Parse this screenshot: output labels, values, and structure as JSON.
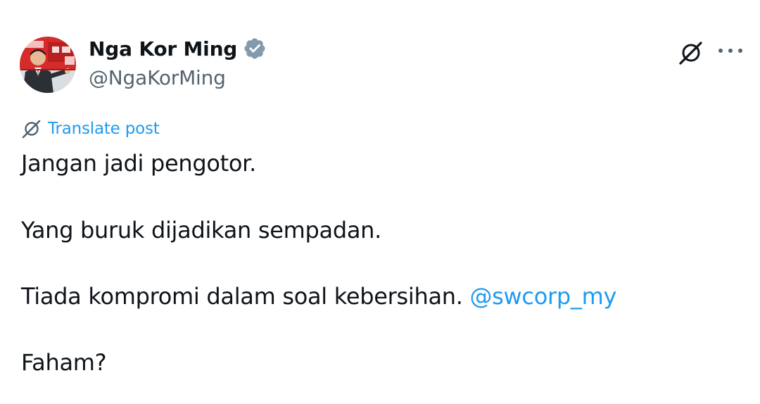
{
  "author": {
    "display_name": "Nga Kor Ming",
    "handle": "@NgaKorMing",
    "verified": true
  },
  "icons": {
    "avatar": "profile-photo",
    "verified": "verified-badge-icon",
    "grok": "grok-icon",
    "more": "more-options-icon",
    "translate": "translate-icon"
  },
  "translate": {
    "label": "Translate post"
  },
  "post": {
    "line1": "Jangan jadi pengotor.",
    "line2": "Yang buruk dijadikan sempadan.",
    "line3": "Tiada kompromi dalam soal kebersihan.",
    "mention": "@swcorp_my",
    "line4": "Faham?"
  },
  "colors": {
    "text": "#0f1419",
    "secondary": "#536471",
    "link": "#1d9bf0",
    "verified_badge": "#829aab"
  }
}
